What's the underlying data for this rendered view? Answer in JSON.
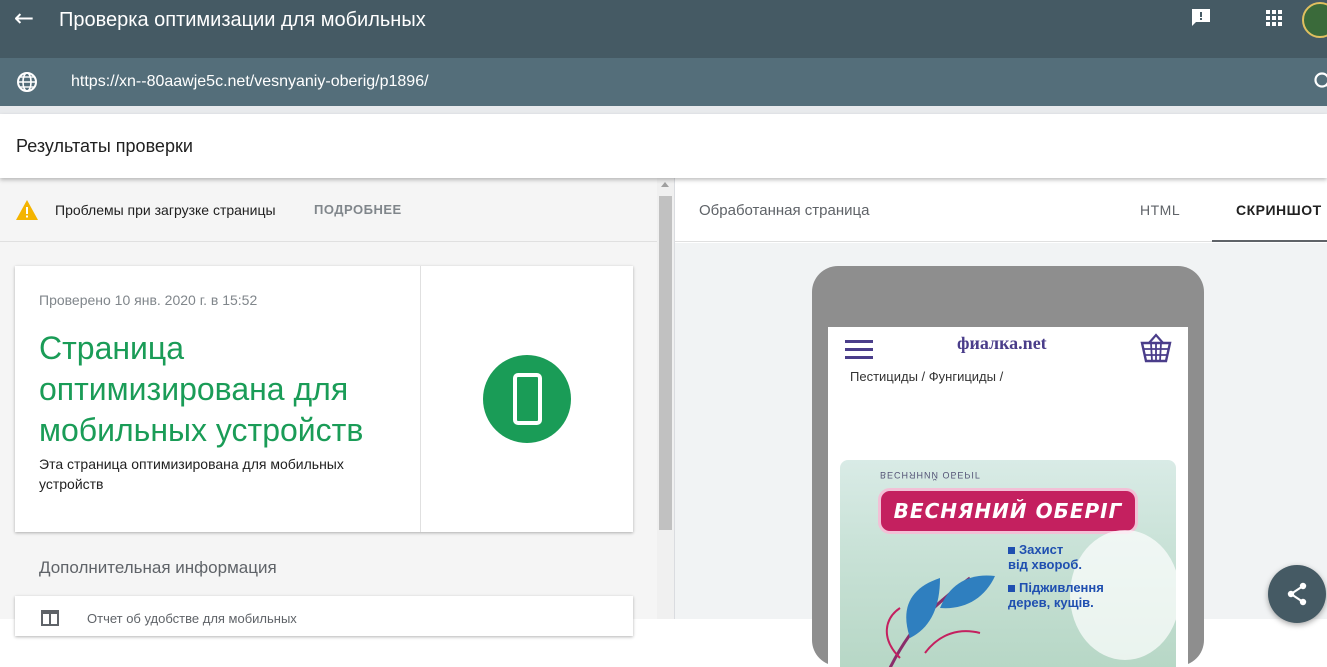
{
  "appbar": {
    "back_icon": "arrow-back-icon",
    "title": "Проверка оптимизации для мобильных",
    "feedback_icon": "feedback-icon",
    "apps_icon": "apps-grid-icon",
    "avatar_icon": "avatar"
  },
  "urlbar": {
    "globe_icon": "globe-icon",
    "url": "https://xn--80aawje5c.net/vesnyaniy-oberig/p1896/",
    "search_icon": "search-icon"
  },
  "results": {
    "header": "Результаты проверки"
  },
  "warning": {
    "text": "Проблемы при загрузке страницы",
    "more": "ПОДРОБНЕЕ"
  },
  "verdict_card": {
    "checked": "Проверено 10 янв. 2020 г. в 15:52",
    "verdict": "Страница оптимизирована для мобильных устройств",
    "description": "Эта страница оптимизирована для мобильных устройств"
  },
  "additional": {
    "title": "Дополнительная информация",
    "usability_report": "Отчет об удобстве для мобильных"
  },
  "right_pane": {
    "processed_label": "Обработанная страница",
    "tabs": [
      {
        "label": "HTML",
        "active": false
      },
      {
        "label": "СКРИНШОТ",
        "active": true
      }
    ]
  },
  "preview": {
    "brand": "фиалка.net",
    "breadcrumb": "Пестициды / Фунгициды /",
    "package": {
      "top_text": "ВЕСНЯНИЙ ОБЕРІГ",
      "banner": "ВЕСНЯНИЙ ОБЕРІГ",
      "line1a": "Захист",
      "line1b": "від хвороб.",
      "line2a": "Підживлення",
      "line2b": "дерев, кущів."
    }
  },
  "colors": {
    "appbar": "#455a64",
    "urlbar": "#546e7a",
    "success_green": "#1a9c57",
    "warning_yellow": "#f4b400",
    "brand_purple": "#4a3d8a",
    "banner_pink": "#c4205f"
  }
}
